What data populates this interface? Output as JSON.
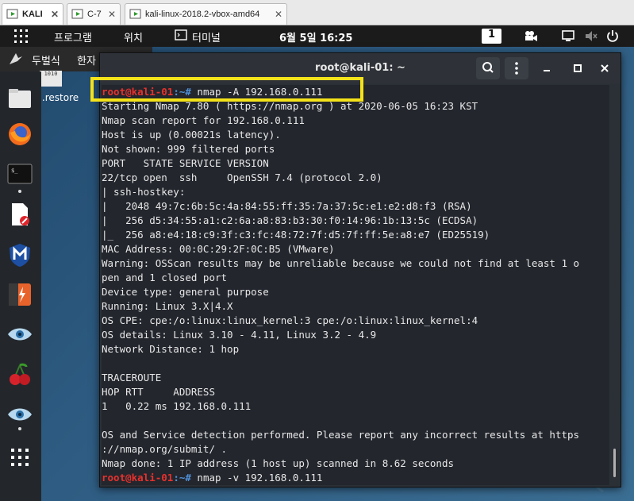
{
  "vbox": {
    "tabs": [
      {
        "label": "KALI"
      },
      {
        "label": "C-7"
      },
      {
        "label": "kali-linux-2018.2-vbox-amd64"
      }
    ],
    "close_glyph": "✕"
  },
  "topbar": {
    "programs": "프로그램",
    "places": "위치",
    "terminal_app": "터미널",
    "clock": "6월 5일  16:25",
    "workspace": "1"
  },
  "ime": {
    "font_name": "두벌식",
    "mode": "한자 전용",
    "menu_glyph": "≡"
  },
  "desktop": {
    "file_label": "dra.restore",
    "file_icon_text": "1010"
  },
  "terminal": {
    "title": "root@kali-01: ~",
    "prompt_user": "root@kali-01",
    "prompt_path": ":~#",
    "lines": [
      {
        "kind": "prompt",
        "cmd": " nmap -A 192.168.0.111"
      },
      {
        "kind": "text",
        "text": "Starting Nmap 7.80 ( https://nmap.org ) at 2020-06-05 16:23 KST"
      },
      {
        "kind": "text",
        "text": "Nmap scan report for 192.168.0.111"
      },
      {
        "kind": "text",
        "text": "Host is up (0.00021s latency)."
      },
      {
        "kind": "text",
        "text": "Not shown: 999 filtered ports"
      },
      {
        "kind": "text",
        "text": "PORT   STATE SERVICE VERSION"
      },
      {
        "kind": "text",
        "text": "22/tcp open  ssh     OpenSSH 7.4 (protocol 2.0)"
      },
      {
        "kind": "text",
        "text": "| ssh-hostkey:"
      },
      {
        "kind": "text",
        "text": "|   2048 49:7c:6b:5c:4a:84:55:ff:35:7a:37:5c:e1:e2:d8:f3 (RSA)"
      },
      {
        "kind": "text",
        "text": "|   256 d5:34:55:a1:c2:6a:a8:83:b3:30:f0:14:96:1b:13:5c (ECDSA)"
      },
      {
        "kind": "text",
        "text": "|_  256 a8:e4:18:c9:3f:c3:fc:48:72:7f:d5:7f:ff:5e:a8:e7 (ED25519)"
      },
      {
        "kind": "text",
        "text": "MAC Address: 00:0C:29:2F:0C:B5 (VMware)"
      },
      {
        "kind": "text",
        "text": "Warning: OSScan results may be unreliable because we could not find at least 1 o"
      },
      {
        "kind": "text",
        "text": "pen and 1 closed port"
      },
      {
        "kind": "text",
        "text": "Device type: general purpose"
      },
      {
        "kind": "text",
        "text": "Running: Linux 3.X|4.X"
      },
      {
        "kind": "text",
        "text": "OS CPE: cpe:/o:linux:linux_kernel:3 cpe:/o:linux:linux_kernel:4"
      },
      {
        "kind": "text",
        "text": "OS details: Linux 3.10 - 4.11, Linux 3.2 - 4.9"
      },
      {
        "kind": "text",
        "text": "Network Distance: 1 hop"
      },
      {
        "kind": "text",
        "text": ""
      },
      {
        "kind": "text",
        "text": "TRACEROUTE"
      },
      {
        "kind": "text",
        "text": "HOP RTT     ADDRESS"
      },
      {
        "kind": "text",
        "text": "1   0.22 ms 192.168.0.111"
      },
      {
        "kind": "text",
        "text": ""
      },
      {
        "kind": "text",
        "text": "OS and Service detection performed. Please report any incorrect results at https"
      },
      {
        "kind": "text",
        "text": "://nmap.org/submit/ ."
      },
      {
        "kind": "text",
        "text": "Nmap done: 1 IP address (1 host up) scanned in 8.62 seconds"
      },
      {
        "kind": "prompt",
        "cmd": " nmap -v 192.168.0.111"
      }
    ]
  },
  "colors": {
    "prompt_user": "#e8312d",
    "prompt_path": "#4f8fd6",
    "highlight": "#f4e21a"
  }
}
